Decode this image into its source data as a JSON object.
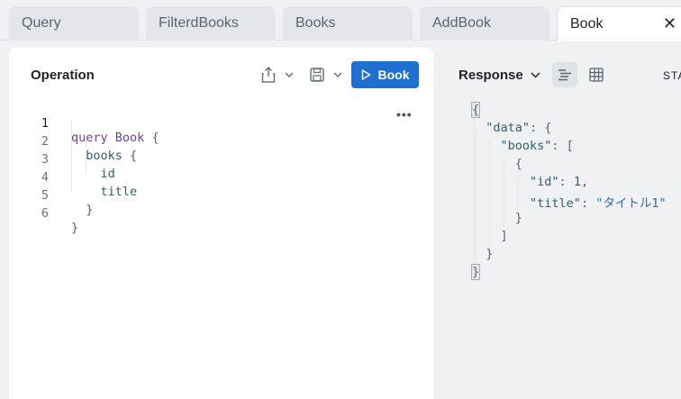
{
  "tabs": [
    {
      "label": "Query"
    },
    {
      "label": "FilterdBooks"
    },
    {
      "label": "Books"
    },
    {
      "label": "AddBook"
    },
    {
      "label": "Book",
      "active": true
    }
  ],
  "operation": {
    "title": "Operation",
    "run_label": "Book",
    "line_numbers": [
      "1",
      "2",
      "3",
      "4",
      "5",
      "6"
    ],
    "code": {
      "l1_kw": "query",
      "l1_name": "Book",
      "l1_brace": "{",
      "l2_field": "books",
      "l2_brace": "{",
      "l3_field": "id",
      "l4_field": "title",
      "l5_brace": "}",
      "l6_brace": "}"
    }
  },
  "response": {
    "title": "Response",
    "status_label": "STA",
    "json": {
      "open": "{",
      "data_key": "\"data\"",
      "books_key": "\"books\"",
      "id_key": "\"id\"",
      "id_val": "1",
      "title_key": "\"title\"",
      "title_val": "\"タイトル1\"",
      "close": "}"
    }
  },
  "colors": {
    "accent": "#1f6fd0"
  }
}
